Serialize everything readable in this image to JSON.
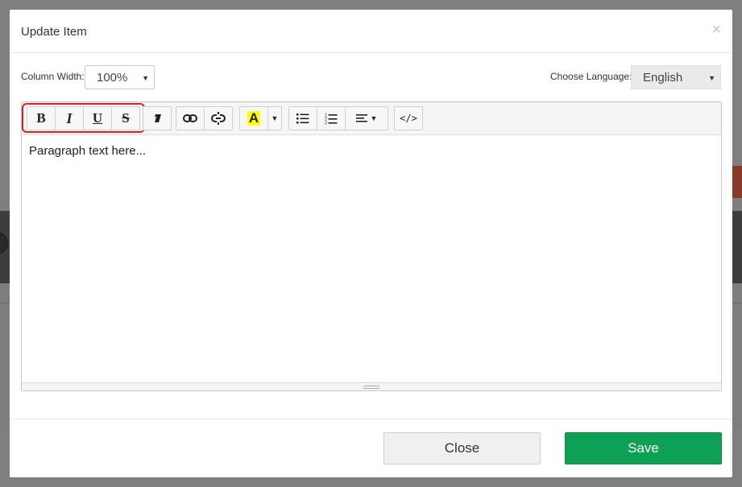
{
  "modal": {
    "title": "Update Item",
    "close_symbol": "×"
  },
  "options": {
    "column_width_label": "Column Width:",
    "column_width_value": "100%",
    "language_label": "Choose Language:",
    "language_value": "English"
  },
  "toolbar": {
    "bold": "B",
    "italic": "I",
    "underline": "U",
    "strikethrough": "S",
    "highlight": "A",
    "code": "</>",
    "highlight_color": "#ffff00"
  },
  "editor": {
    "content": "Paragraph text here..."
  },
  "footer": {
    "close_label": "Close",
    "save_label": "Save"
  },
  "colors": {
    "save_button": "#0ea055",
    "highlight_ring": "#e02020"
  },
  "icons": [
    "eraser-icon",
    "link-icon",
    "unlink-icon",
    "unordered-list-icon",
    "ordered-list-icon",
    "align-icon",
    "caret-down-icon",
    "close-icon",
    "resize-grip-icon"
  ]
}
